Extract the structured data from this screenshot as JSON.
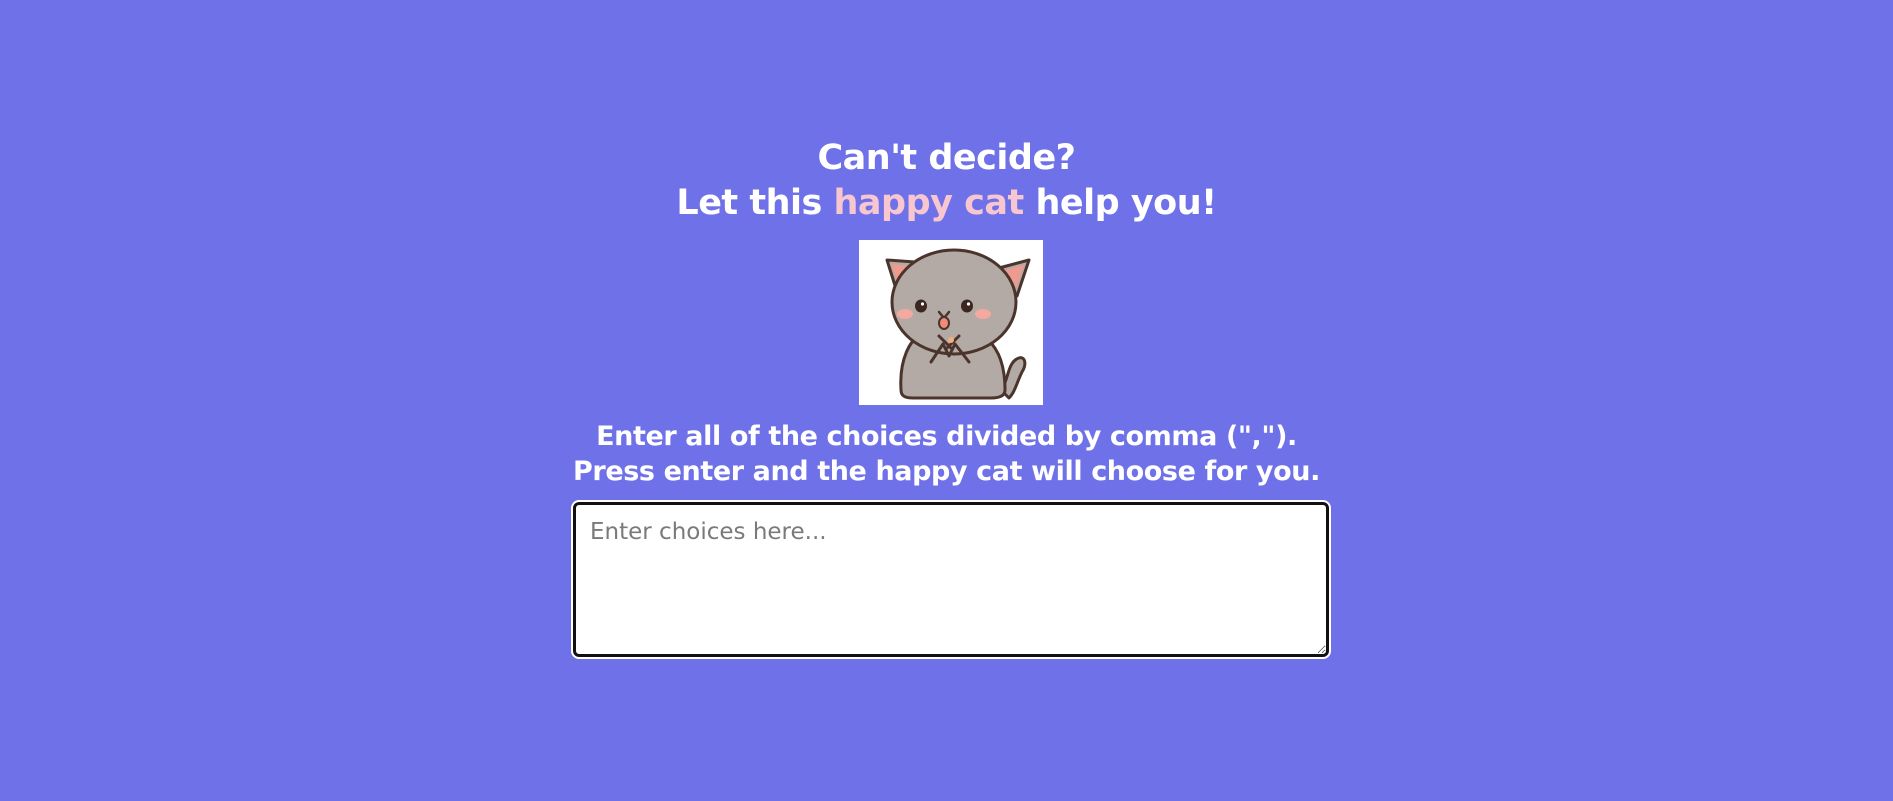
{
  "header": {
    "line1": "Can't decide?",
    "line2_prefix": "Let this ",
    "line2_accent": "happy cat",
    "line2_suffix": " help you!"
  },
  "colors": {
    "background": "#6f71e9",
    "text": "#ffffff",
    "accent": "#f7c6cf"
  },
  "cat_image": {
    "icon": "happy-cat-icon"
  },
  "instructions": {
    "line1": "Enter all of the choices divided by comma (\",\").",
    "line2": "Press enter and the happy cat will choose for you."
  },
  "choices_input": {
    "placeholder": "Enter choices here...",
    "value": ""
  }
}
